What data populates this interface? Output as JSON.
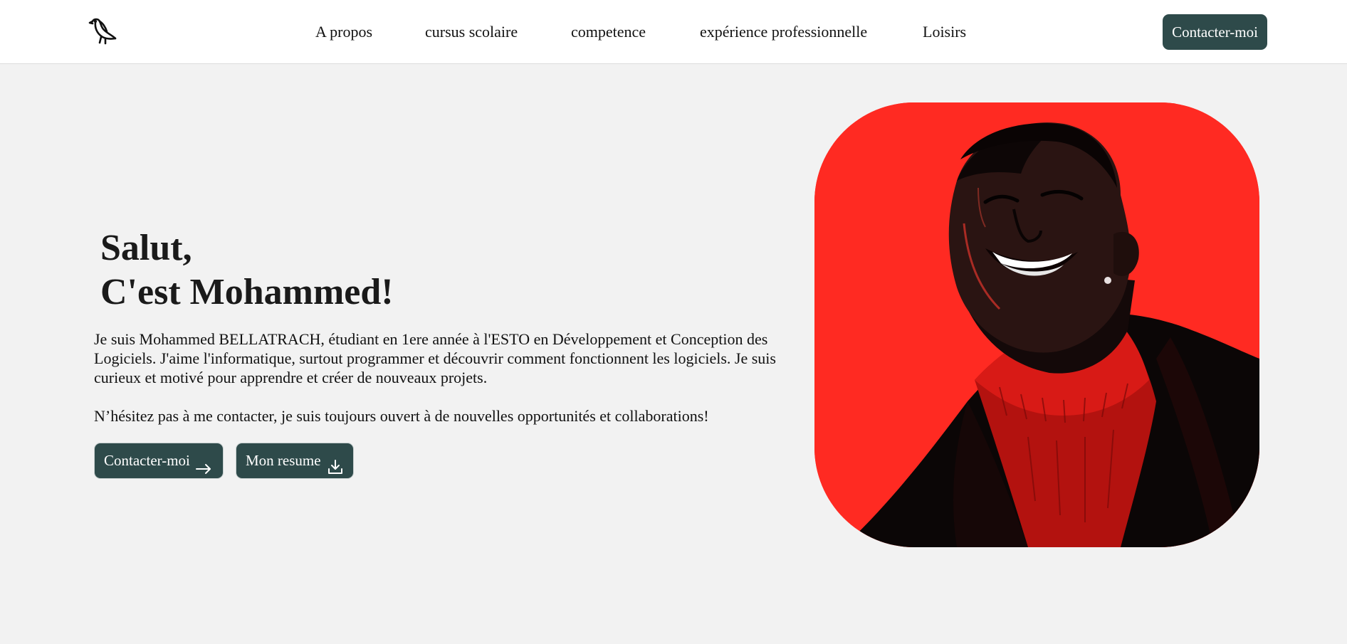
{
  "nav": {
    "logo_icon": "bird-icon",
    "links": [
      "A propos",
      "cursus scolaire",
      "competence",
      "expérience professionnelle",
      "Loisirs"
    ],
    "cta_label": "Contacter-moi"
  },
  "hero": {
    "title_line1": "Salut,",
    "title_line2": "C'est Mohammed!",
    "intro": "Je suis Mohammed BELLATRACH, étudiant en 1ere année à l'ESTO en Développement et Conception des Logiciels. J'aime l'informatique, surtout programmer et découvrir comment fonctionnent les logiciels. Je suis curieux et motivé pour apprendre et créer de nouveaux projets.",
    "invite": "N’hésitez pas à me contacter, je suis toujours ouvert à de nouvelles opportunités et collaborations!",
    "buttons": {
      "contact_label": "Contacter-moi",
      "contact_icon": "arrow-right-icon",
      "resume_label": "Mon resume",
      "resume_icon": "download-icon"
    },
    "portrait_icon": "portrait-illustration"
  },
  "colors": {
    "accent": "#2e4a4a",
    "background": "#f2f2f2",
    "portrait_bg": "#ff2a22"
  }
}
